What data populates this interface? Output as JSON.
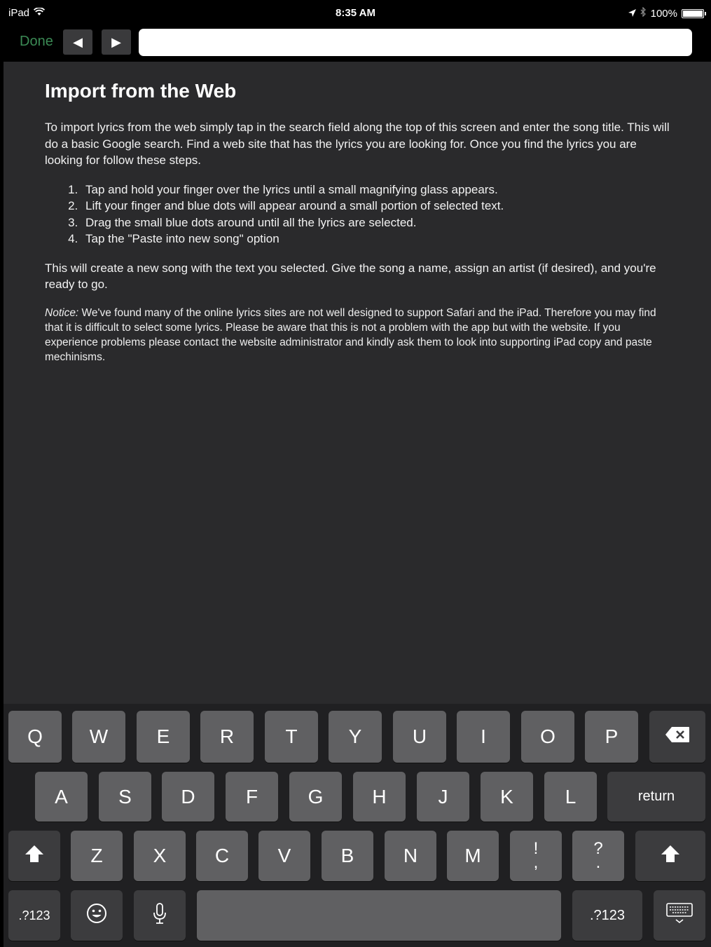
{
  "status_bar": {
    "device": "iPad",
    "time": "8:35 AM",
    "battery": "100%",
    "icons": [
      "wifi-icon",
      "location-arrow-icon",
      "bluetooth-icon",
      "battery-icon"
    ]
  },
  "toolbar": {
    "done_label": "Done",
    "back_glyph": "◀",
    "forward_glyph": "▶",
    "search_value": "",
    "accent_color": "#3b8a55"
  },
  "content": {
    "title": "Import from the Web",
    "intro": "To import lyrics from the web simply tap in the search field along the top of this screen and enter the song title. This will do a basic Google search. Find a web site that has the lyrics you are looking for. Once you find the lyrics you are looking for follow these steps.",
    "steps": [
      "Tap and hold your finger over the lyrics until a small magnifying glass appears.",
      "Lift your finger and blue dots will appear around a small portion of selected text.",
      "Drag the small blue dots around until all the lyrics are selected.",
      "Tap the \"Paste into new song\" option"
    ],
    "outro": "This will create a new song with the text you selected. Give the song a name, assign an artist (if desired), and you're ready to go.",
    "notice_label": "Notice:",
    "notice_text": " We've found many of the online lyrics sites are not well designed to support Safari and the iPad. Therefore you may find that it is difficult to select some lyrics. Please be aware that this is not a problem with the app but with the website. If you experience problems please contact the website administrator and kindly ask them to look into supporting iPad copy and paste mechinisms."
  },
  "keyboard": {
    "row1": [
      "Q",
      "W",
      "E",
      "R",
      "T",
      "Y",
      "U",
      "I",
      "O",
      "P"
    ],
    "row2": [
      "A",
      "S",
      "D",
      "F",
      "G",
      "H",
      "J",
      "K",
      "L"
    ],
    "row3": [
      "Z",
      "X",
      "C",
      "V",
      "B",
      "N",
      "M"
    ],
    "punct1": [
      "!",
      ","
    ],
    "punct2": [
      "?",
      "."
    ],
    "return_label": "return",
    "numbers_label": ".?123",
    "numbers_label_right": ".?123",
    "space_label": ""
  }
}
